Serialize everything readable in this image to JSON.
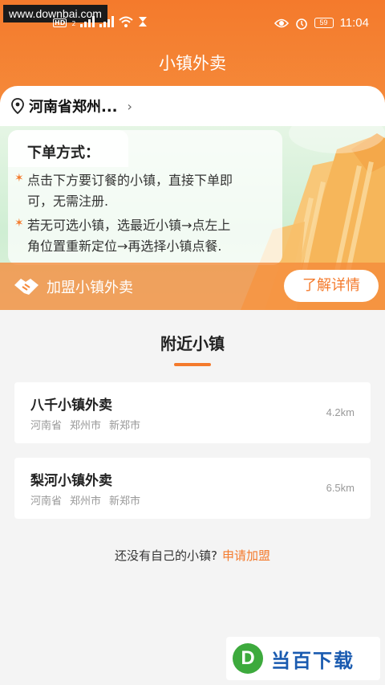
{
  "status_bar": {
    "watermark": "www.downbai.com",
    "time": "11:04",
    "battery": "59",
    "network_badges": [
      "HD",
      "2"
    ]
  },
  "header": {
    "title": "小镇外卖"
  },
  "location": {
    "text": "河南省郑州..."
  },
  "instructions": {
    "title": "下单方式：",
    "items": [
      {
        "line1": "点击下方要订餐的小镇，直接下单即",
        "line2": "可，无需注册."
      },
      {
        "line1": "若无可选小镇，选最近小镇→点左上",
        "line2": "角位置重新定位→再选择小镇点餐."
      }
    ]
  },
  "join": {
    "label": "加盟小镇外卖",
    "button": "了解详情"
  },
  "nearby": {
    "title": "附近小镇",
    "towns": [
      {
        "name": "八千小镇外卖",
        "province": "河南省",
        "city": "郑州市",
        "district": "新郑市",
        "distance": "4.2km"
      },
      {
        "name": "梨河小镇外卖",
        "province": "河南省",
        "city": "郑州市",
        "district": "新郑市",
        "distance": "6.5km"
      }
    ]
  },
  "footer": {
    "prompt": "还没有自己的小镇?",
    "link": "申请加盟"
  },
  "watermark_bottom": {
    "logo": "D",
    "text": "当百下载"
  },
  "colors": {
    "accent": "#f47a2c",
    "banner_green": "#cfeed3"
  }
}
